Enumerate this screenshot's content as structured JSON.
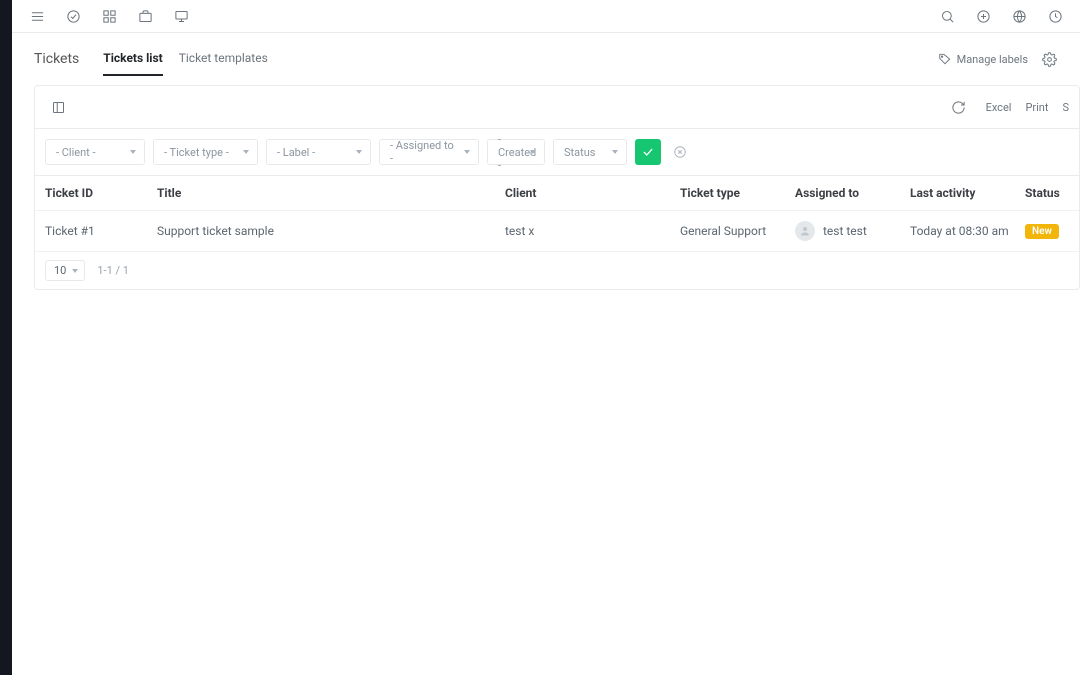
{
  "page": {
    "title": "Tickets"
  },
  "tabs": {
    "list": "Tickets list",
    "templates": "Ticket templates"
  },
  "headerActions": {
    "manageLabels": "Manage labels"
  },
  "toolbar": {
    "excel": "Excel",
    "print": "Print",
    "shortS": "S"
  },
  "filters": {
    "client": "- Client -",
    "ticketType": "- Ticket type -",
    "label": "- Label -",
    "assignedTo": "- Assigned to -",
    "created": "- Created -",
    "status": "Status"
  },
  "columns": {
    "ticketId": "Ticket ID",
    "title": "Title",
    "client": "Client",
    "ticketType": "Ticket type",
    "assignedTo": "Assigned to",
    "lastActivity": "Last activity",
    "status": "Status"
  },
  "rows": [
    {
      "id": "Ticket #1",
      "title": "Support ticket sample",
      "client": "test x",
      "type": "General Support",
      "assignedTo": "test test",
      "lastActivity": "Today at 08:30 am",
      "status": "New"
    }
  ],
  "pagination": {
    "pageSize": "10",
    "info": "1-1 / 1"
  }
}
